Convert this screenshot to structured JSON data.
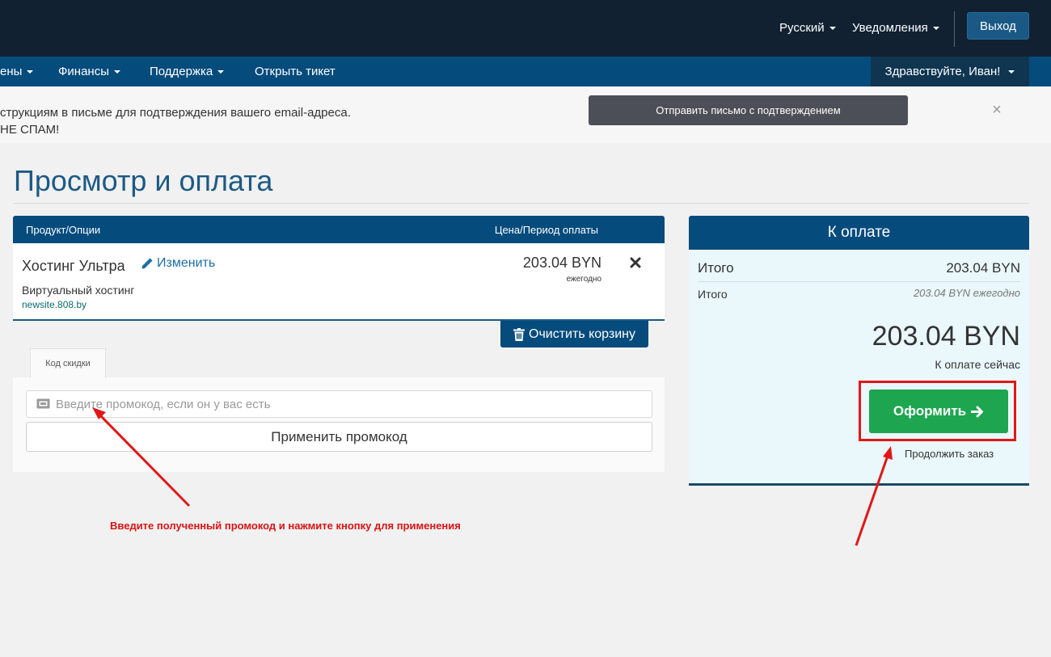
{
  "header": {
    "language": "Русский",
    "notifications": "Уведомления",
    "logout": "Выход"
  },
  "nav": {
    "items": [
      "ены",
      "Финансы",
      "Поддержка",
      "Открыть тикет"
    ],
    "greeting": "Здравствуйте, Иван!"
  },
  "alert": {
    "text_line1": "струкциям в письме для подтверждения вашего email-адреса.",
    "text_line2": " НЕ СПАМ!",
    "send_button": "Отправить письмо с подтверждением",
    "close": "×"
  },
  "page": {
    "title": "Просмотр и оплата"
  },
  "cart": {
    "col_product": "Продукт/Опции",
    "col_price": "Цена/Период оплаты",
    "item": {
      "name": "Хостинг Ультра",
      "edit": "Изменить",
      "group": "Виртуальный хостинг",
      "domain": "newsite.808.by",
      "price": "203.04 BYN",
      "cycle": "ежегодно"
    },
    "clear_button": "Очистить корзину"
  },
  "promo": {
    "tab": "Код скидки",
    "placeholder": "Введите промокод, если он у вас есть",
    "apply_button": "Применить промокод"
  },
  "summary": {
    "title": "К оплате",
    "subtotal_label": "Итого",
    "subtotal_value": "203.04 BYN",
    "recurring_label": "Итого",
    "recurring_value": "203.04 BYN ежегодно",
    "total": "203.04 BYN",
    "total_label": "К оплате сейчас",
    "checkout_button": "Оформить",
    "continue_link": "Продолжить заказ"
  },
  "annotation": {
    "text": "Введите полученный промокод и нажмите кнопку для применения",
    "color": "#e01818"
  },
  "colors": {
    "header_bg": "#112132",
    "nav_bg": "#054b7c",
    "accent": "#1c5a84",
    "checkout": "#1da64f"
  }
}
